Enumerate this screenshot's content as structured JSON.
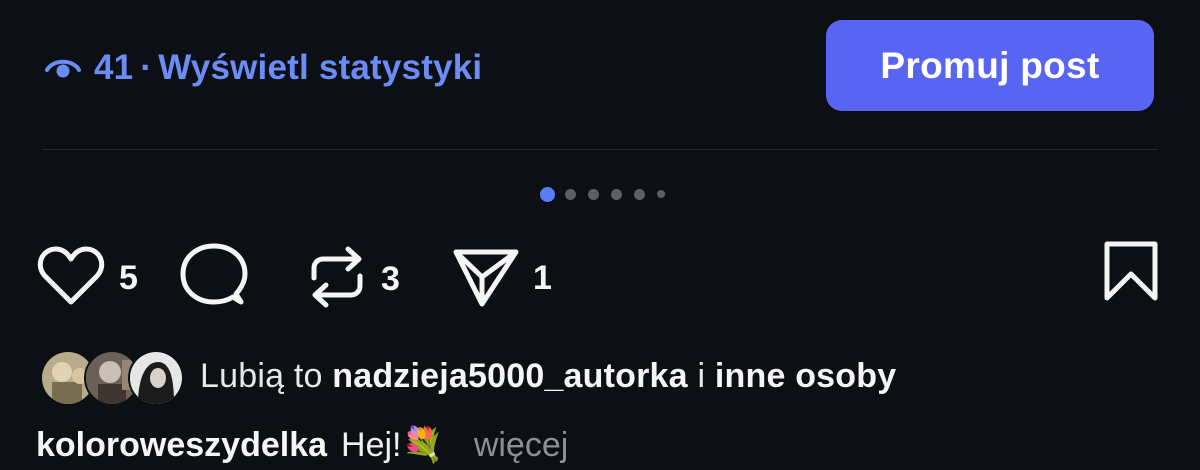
{
  "stats": {
    "views": "41",
    "separator": "·",
    "link_label": "Wyświetl statystyki",
    "eye_icon": "eye-icon"
  },
  "promote": {
    "label": "Promuj post",
    "color": "#5865f2"
  },
  "carousel": {
    "total": 6,
    "active_index": 0,
    "accent": "#5b7cf7"
  },
  "actions": {
    "like_count": "5",
    "repost_count": "3",
    "share_count": "1"
  },
  "likes": {
    "prefix": "Lubią to",
    "user": "nadzieja5000_autorka",
    "connector": "i",
    "rest": "inne osoby"
  },
  "caption": {
    "author": "koloroweszydelka",
    "text": "Hej!💐",
    "more": "więcej"
  }
}
